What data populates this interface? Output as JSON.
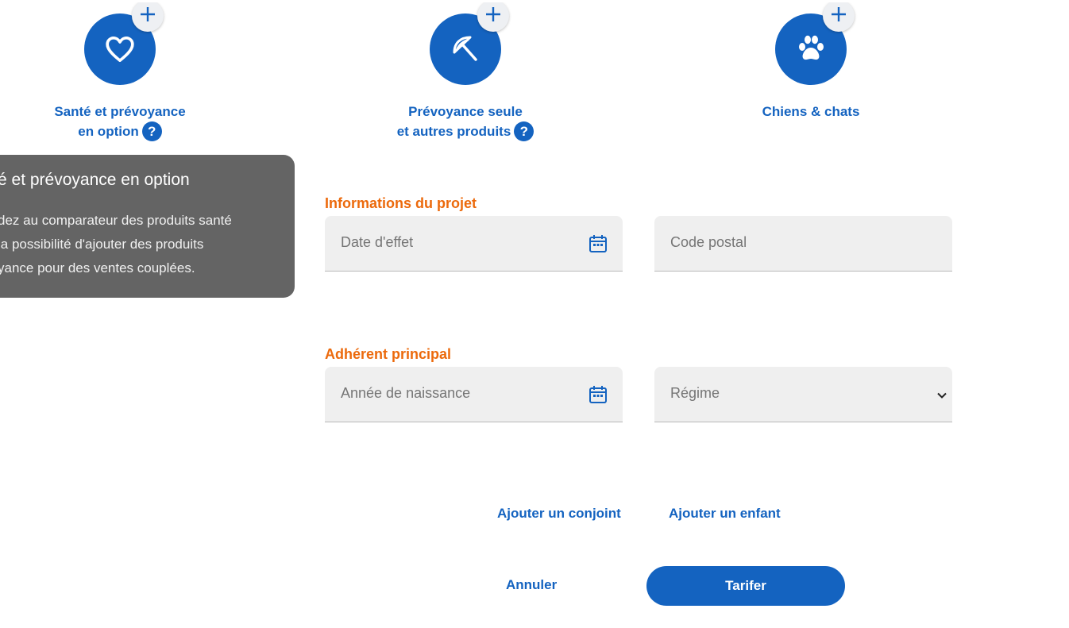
{
  "products": [
    {
      "line1": "Santé et prévoyance",
      "line2": "en option",
      "icon": "heart-icon",
      "help": "?"
    },
    {
      "line1": "Prévoyance seule",
      "line2": "et autres produits",
      "icon": "umbrella-icon",
      "help": "?"
    },
    {
      "line1": "Chiens & chats",
      "icon": "paw-icon"
    }
  ],
  "tooltip": {
    "title": "é et prévoyance en option",
    "lines": [
      "dez au comparateur des produits santé",
      "la possibilité d'ajouter des produits",
      "yance pour des ventes couplées."
    ]
  },
  "project": {
    "title": "Informations du projet",
    "date_placeholder": "Date d'effet",
    "postal_placeholder": "Code postal"
  },
  "member": {
    "title": "Adhérent principal",
    "birth_placeholder": "Année de naissance",
    "regime_placeholder": "Régime"
  },
  "actions": {
    "add_spouse": "Ajouter un conjoint",
    "add_child": "Ajouter un enfant",
    "cancel": "Annuler",
    "submit": "Tarifer"
  },
  "colors": {
    "primary": "#1463c0",
    "accent": "#ec6a0c",
    "tooltip_bg": "#646464",
    "field_bg": "#efefef"
  }
}
